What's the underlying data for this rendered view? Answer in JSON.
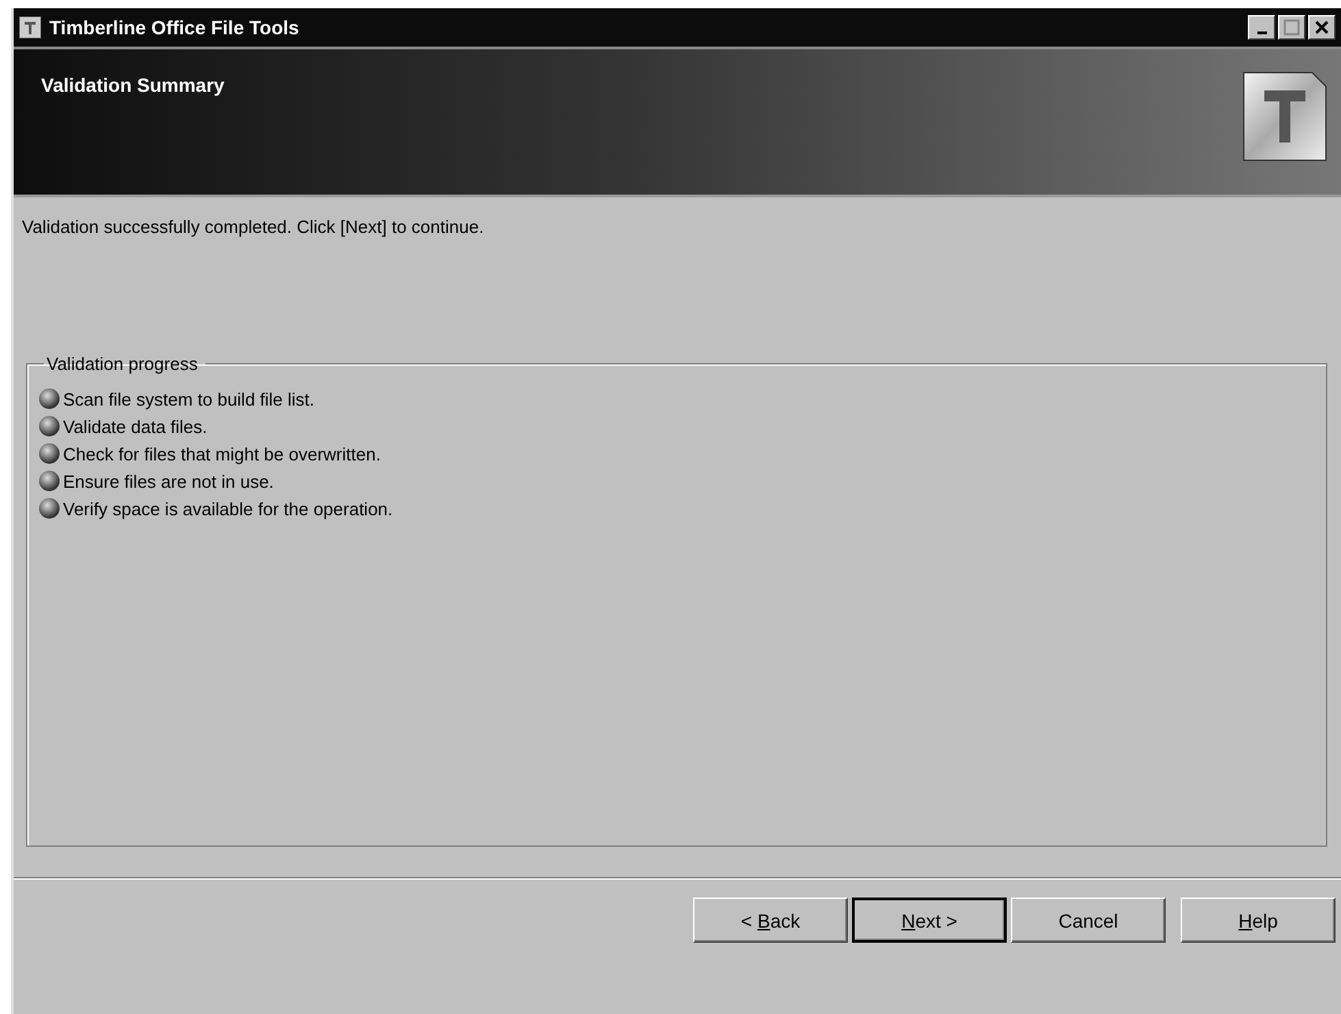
{
  "window": {
    "title": "Timberline Office File Tools"
  },
  "header": {
    "title": "Validation Summary"
  },
  "message": "Validation successfully completed. Click [Next] to continue.",
  "progress_group": {
    "label": "Validation progress",
    "steps": [
      {
        "text": "Scan file system to build file list."
      },
      {
        "text": "Validate data files."
      },
      {
        "text": "Check for files that might be overwritten."
      },
      {
        "text": "Ensure files are not in use."
      },
      {
        "text": "Verify space is available for the operation."
      }
    ]
  },
  "buttons": [
    {
      "before": "< ",
      "key": "B",
      "after": "ack",
      "default": false
    },
    {
      "key": "N",
      "after": "ext >",
      "default": true
    },
    {
      "before": "Cancel",
      "default": false
    },
    {
      "key": "H",
      "after": "elp",
      "default": false
    }
  ]
}
